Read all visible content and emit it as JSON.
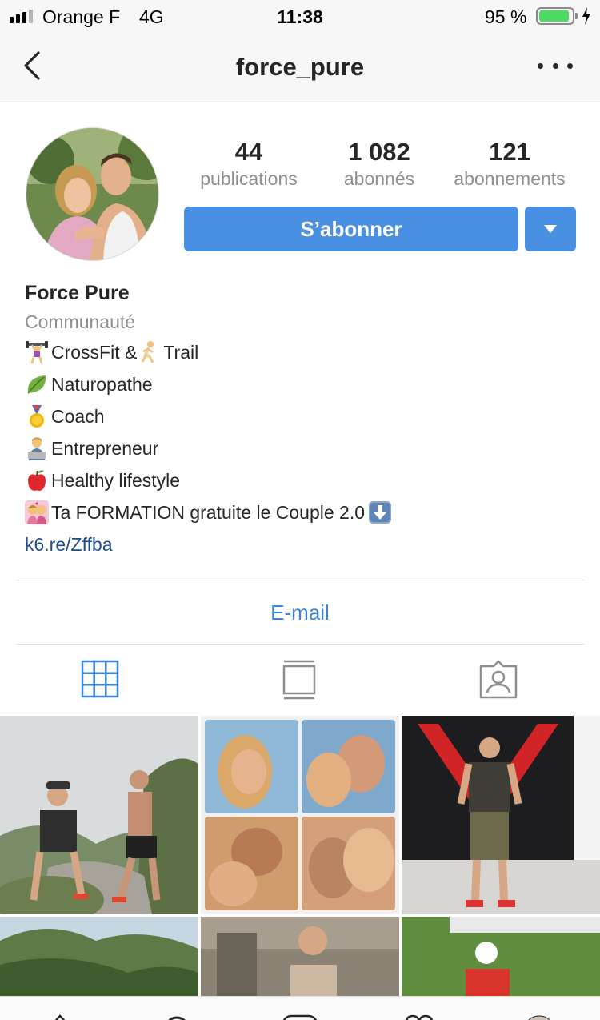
{
  "status_bar": {
    "carrier": "Orange F",
    "network": "4G",
    "time": "11:38",
    "battery": "95 %"
  },
  "nav": {
    "title": "force_pure"
  },
  "stats": [
    {
      "value": "44",
      "label": "publications"
    },
    {
      "value": "1 082",
      "label": "abonnés"
    },
    {
      "value": "121",
      "label": "abonnements"
    }
  ],
  "follow_label": "S’abonner",
  "bio": {
    "name": "Force Pure",
    "category": "Communauté",
    "lines": [
      "CrossFit & ",
      "Trail",
      "Naturopathe",
      "Coach",
      "Entrepreneur",
      "Healthy lifestyle",
      " Ta FORMATION gratuite le Couple 2.0 "
    ],
    "link": "k6.re/Zffba"
  },
  "email_label": "E-mail",
  "colors": {
    "accent": "#4a90e2",
    "link": "#1e4d8c",
    "email": "#3a86d8"
  },
  "tabs": [
    "grid-icon",
    "feed-icon",
    "tagged-icon"
  ]
}
